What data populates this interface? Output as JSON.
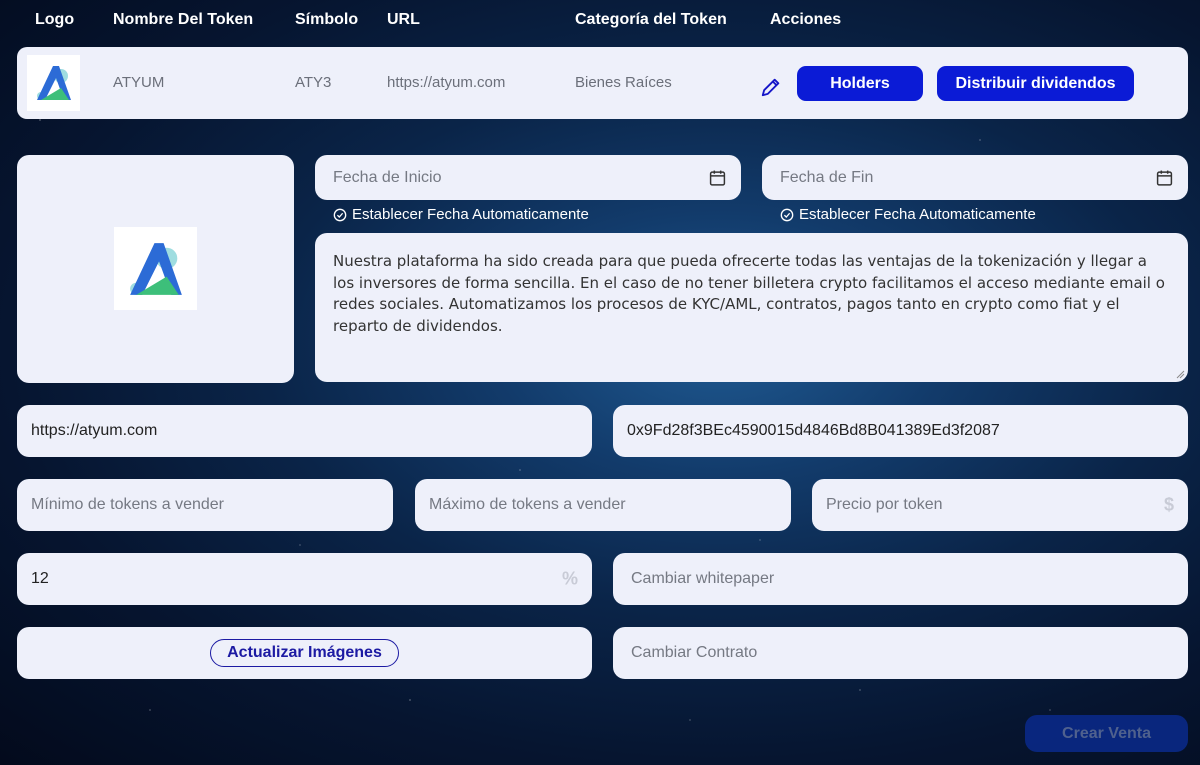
{
  "table_header": {
    "logo": "Logo",
    "name": "Nombre Del Token",
    "symbol": "Símbolo",
    "url": "URL",
    "category": "Categoría del Token",
    "actions": "Acciones"
  },
  "token": {
    "name": "ATYUM",
    "symbol": "ATY3",
    "url": "https://atyum.com",
    "category": "Bienes Raíces",
    "holders_label": "Holders",
    "dividends_label": "Distribuir dividendos"
  },
  "form": {
    "start_date_placeholder": "Fecha de Inicio",
    "end_date_placeholder": "Fecha de Fin",
    "auto_date_label": "Establecer Fecha Automaticamente",
    "description": "Nuestra plataforma ha sido creada para que pueda ofrecerte todas las ventajas de la tokenización y llegar a los inversores de forma sencilla. En el caso de no tener billetera crypto facilitamos el acceso mediante email o redes sociales. Automatizamos los procesos de KYC/AML, contratos, pagos tanto en crypto como fiat y el reparto de dividendos.",
    "url_value": "https://atyum.com",
    "contract_address": "0x9Fd28f3BEc4590015d4846Bd8B041389Ed3f2087",
    "min_tokens_placeholder": "Mínimo de tokens a vender",
    "max_tokens_placeholder": "Máximo de tokens a vender",
    "price_placeholder": "Precio por token",
    "price_suffix": "$",
    "percent_value": "12",
    "percent_suffix": "%",
    "whitepaper_placeholder": "Cambiar whitepaper",
    "update_images_label": "Actualizar Imágenes",
    "contract_placeholder": "Cambiar Contrato",
    "submit_label": "Crear Venta"
  },
  "colors": {
    "accent": "#0b1bd6",
    "panel": "#eef0fa"
  }
}
